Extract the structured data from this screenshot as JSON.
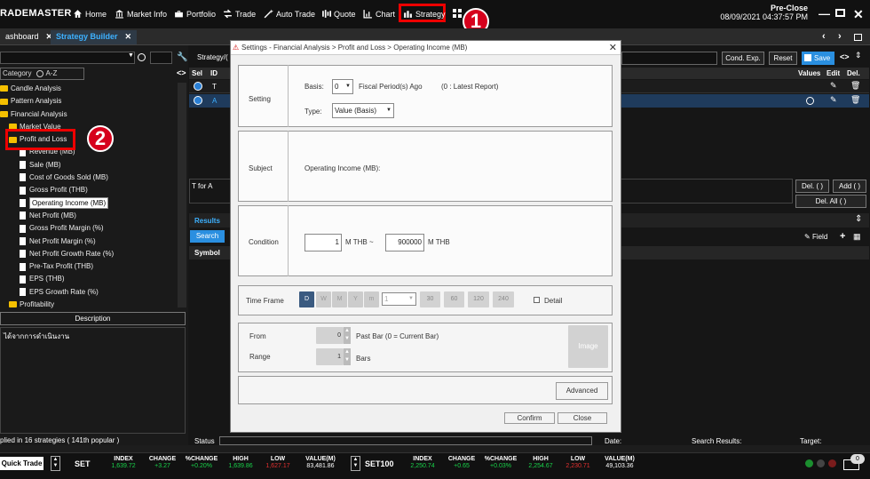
{
  "app": {
    "logo": "RADEMASTER"
  },
  "nav": [
    {
      "label": "Home",
      "icon": "home-icon"
    },
    {
      "label": "Market Info",
      "icon": "bank-icon"
    },
    {
      "label": "Portfolio",
      "icon": "briefcase-icon"
    },
    {
      "label": "Trade",
      "icon": "trade-icon"
    },
    {
      "label": "Auto Trade",
      "icon": "magic-wand-icon"
    },
    {
      "label": "Quote",
      "icon": "quote-icon"
    },
    {
      "label": "Chart",
      "icon": "chart-icon"
    },
    {
      "label": "Strategy",
      "icon": "strategy-icon"
    }
  ],
  "annotations": {
    "one": "1",
    "two": "2"
  },
  "status": {
    "session": "Pre-Close",
    "datetime": "08/09/2021 04:37:57 PM"
  },
  "tabs": [
    {
      "label": "ashboard"
    },
    {
      "label": "Strategy Builder"
    }
  ],
  "left": {
    "category_label": "Category",
    "az_label": "A-Z",
    "tree": [
      "Candle Analysis",
      "Pattern Analysis",
      "Financial Analysis",
      "Market Value",
      "Profit and Loss",
      "Revenue (MB)",
      "Sale (MB)",
      "Cost of Goods Sold (MB)",
      "Gross Profit (THB)",
      "Operating Income (MB)",
      "Net Profit (MB)",
      "Gross Profit Margin (%)",
      "Net Profit Margin (%)",
      "Net Profit Growth Rate (%)",
      "Pre-Tax Profit (THB)",
      "EPS (THB)",
      "EPS Growth Rate (%)",
      "Profitability"
    ],
    "description_label": "Description",
    "description_text": "ได้จากการดำเนินงาน",
    "footer": "plied in 16 strategies ( 141th popular )"
  },
  "mid": {
    "strategy_label": "Strategy/(",
    "cond_exp": "Cond. Exp.",
    "reset": "Reset",
    "save": "Save",
    "cols": {
      "sel": "Sel",
      "id": "ID",
      "values": "Values",
      "edit": "Edit",
      "del": "Del."
    },
    "rows": [
      {
        "id": "T"
      },
      {
        "id": "A"
      }
    ],
    "tfora": "T for A",
    "del_btn": "Del. ( )",
    "add_btn": "Add ( )",
    "del_all": "Del. All ( )",
    "results": "Results",
    "search": "Search",
    "symbol": "Symbol",
    "field": "Field",
    "status": "Status",
    "date": "Date:",
    "search_results": "Search Results:",
    "target": "Target:"
  },
  "dialog": {
    "title": "Settings - Financial Analysis > Profit and Loss > Operating Income (MB)",
    "setting": "Setting",
    "basis_label": "Basis:",
    "basis_value": "0",
    "fiscal": "Fiscal Period(s) Ago",
    "latest": "(0 : Latest Report)",
    "type_label": "Type:",
    "type_value": "Value (Basis)",
    "subject": "Subject",
    "subject_text": "Operating Income (MB):",
    "condition": "Condition",
    "cond_min": "1",
    "unit_min": "M THB ~",
    "cond_max": "900000",
    "unit_max": "M THB",
    "timeframe": "Time Frame",
    "tf": [
      "D",
      "W",
      "M",
      "Y",
      "m"
    ],
    "tf_minutes": "1",
    "tf_presets": [
      "30",
      "60",
      "120",
      "240"
    ],
    "detail": "Detail",
    "from": "From",
    "from_value": "0",
    "past_bar": "Past Bar (0 = Current Bar)",
    "range": "Range",
    "range_value": "1",
    "bars": "Bars",
    "image": "Image",
    "advanced": "Advanced",
    "confirm": "Confirm",
    "close": "Close"
  },
  "market": {
    "quick_trade": "Quick Trade",
    "set": {
      "name": "SET",
      "index": "1,639.72",
      "change": "+3.27",
      "pchange": "+0.20%",
      "high": "1,639.86",
      "low": "1,627.17",
      "value": "83,481.86"
    },
    "set100": {
      "name": "SET100",
      "index": "2,250.74",
      "change": "+0.65",
      "pchange": "+0.03%",
      "high": "2,254.67",
      "low": "2,230.71",
      "value": "49,103.36"
    },
    "hdr": {
      "index": "INDEX",
      "change": "CHANGE",
      "pchange": "%CHANGE",
      "high": "HIGH",
      "low": "LOW",
      "value": "VALUE(M)"
    },
    "mail_count": "0"
  }
}
